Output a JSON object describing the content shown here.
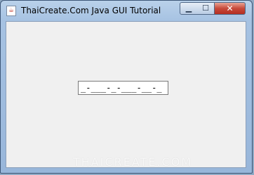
{
  "window": {
    "title": "ThaiCreate.Com Java GUI Tutorial",
    "icon": "java-cup-icon",
    "controls": {
      "minimize": "minimize-icon",
      "maximize": "maximize-icon",
      "close": "close-icon",
      "minimize_glyph": "▁",
      "maximize_glyph": "☐",
      "close_glyph": "✕"
    }
  },
  "form": {
    "masked_field_value": "_-___-_-___-__-_"
  },
  "watermark": {
    "text": "THAICREATE.COM"
  },
  "colors": {
    "client_background": "#f0f0f0",
    "titlebar": "#a6c2e2",
    "close_button": "#c7493a"
  }
}
